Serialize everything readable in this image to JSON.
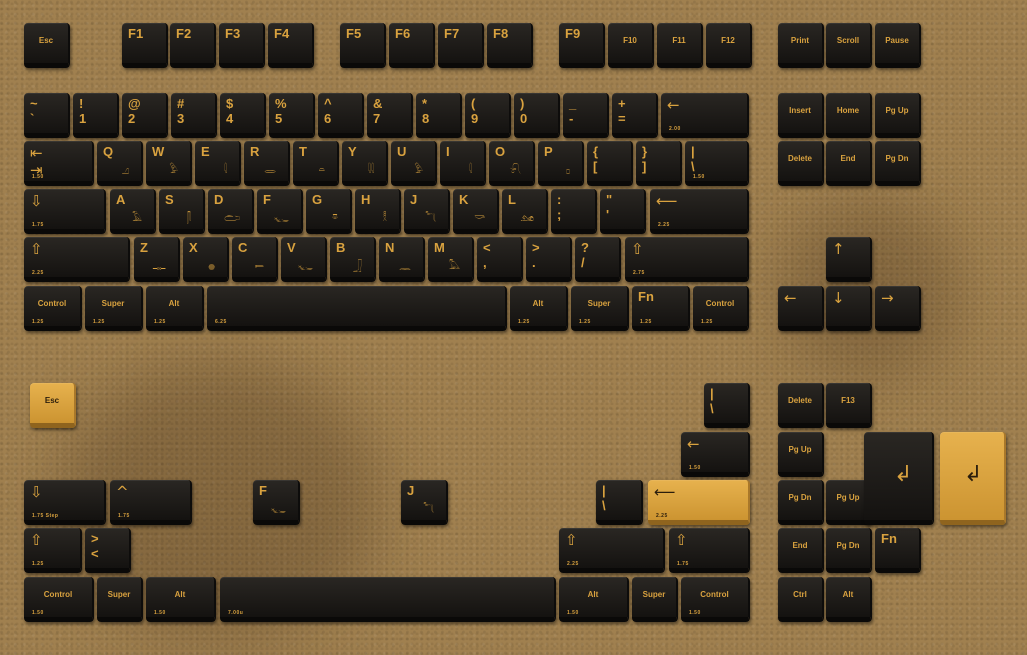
{
  "colors": {
    "mat": "#a0804f",
    "keycap": "#1e1b18",
    "legend": "#d9a23f",
    "accent_cap": "#dca540"
  },
  "main_board": {
    "function_row": [
      {
        "label": "Esc"
      },
      {
        "label": "F1"
      },
      {
        "label": "F2"
      },
      {
        "label": "F3"
      },
      {
        "label": "F4"
      },
      {
        "label": "F5"
      },
      {
        "label": "F6"
      },
      {
        "label": "F7"
      },
      {
        "label": "F8"
      },
      {
        "label": "F9"
      },
      {
        "label": "F10"
      },
      {
        "label": "F11"
      },
      {
        "label": "F12"
      }
    ],
    "system_keys": [
      {
        "label": "Print"
      },
      {
        "label": "Scroll"
      },
      {
        "label": "Pause"
      }
    ],
    "number_row": [
      {
        "label": "~\n`"
      },
      {
        "label": "!\n1"
      },
      {
        "label": "@\n2"
      },
      {
        "label": "#\n3"
      },
      {
        "label": "$\n4"
      },
      {
        "label": "%\n5"
      },
      {
        "label": "^\n6"
      },
      {
        "label": "&\n7"
      },
      {
        "label": "*\n8"
      },
      {
        "label": "(\n9"
      },
      {
        "label": ")\n0"
      },
      {
        "label": "_\n-"
      },
      {
        "label": "+\n="
      },
      {
        "label": "←",
        "size": "2.00"
      }
    ],
    "nav_cluster": [
      {
        "label": "Insert"
      },
      {
        "label": "Home"
      },
      {
        "label": "Pg Up"
      },
      {
        "label": "Delete"
      },
      {
        "label": "End"
      },
      {
        "label": "Pg Dn"
      }
    ],
    "top_row": [
      {
        "label": "⇤\n⇥",
        "size": "1.50"
      },
      {
        "label": "Q",
        "glyph": "𓈎"
      },
      {
        "label": "W",
        "glyph": "𓅱"
      },
      {
        "label": "E",
        "glyph": "𓇋"
      },
      {
        "label": "R",
        "glyph": "𓂋"
      },
      {
        "label": "T",
        "glyph": "𓏏"
      },
      {
        "label": "Y",
        "glyph": "𓇌"
      },
      {
        "label": "U",
        "glyph": "𓅱"
      },
      {
        "label": "I",
        "glyph": "𓇋"
      },
      {
        "label": "O",
        "glyph": "𓍯"
      },
      {
        "label": "P",
        "glyph": "𓊪"
      },
      {
        "label": "{\n["
      },
      {
        "label": "}\n]"
      },
      {
        "label": "|\n\\",
        "size": "1.50"
      }
    ],
    "home_row": [
      {
        "label": "⇩",
        "size": "1.75"
      },
      {
        "label": "A",
        "glyph": "𓄿"
      },
      {
        "label": "S",
        "glyph": "𓋴"
      },
      {
        "label": "D",
        "glyph": "𓂧"
      },
      {
        "label": "F",
        "glyph": "𓆑"
      },
      {
        "label": "G",
        "glyph": "𓎼"
      },
      {
        "label": "H",
        "glyph": "𓎛"
      },
      {
        "label": "J",
        "glyph": "𓆓"
      },
      {
        "label": "K",
        "glyph": "𓎡"
      },
      {
        "label": "L",
        "glyph": "𓃭"
      },
      {
        "label": ":\n;"
      },
      {
        "label": "\"\n'"
      },
      {
        "label": "⟵",
        "size": "2.25"
      }
    ],
    "bottom_row": [
      {
        "label": "⇧",
        "size": "2.25"
      },
      {
        "label": "Z",
        "glyph": "𓊃"
      },
      {
        "label": "X",
        "glyph": "𓐍"
      },
      {
        "label": "C",
        "glyph": "𓍿"
      },
      {
        "label": "V",
        "glyph": "𓆑"
      },
      {
        "label": "B",
        "glyph": "𓃀"
      },
      {
        "label": "N",
        "glyph": "𓈖"
      },
      {
        "label": "M",
        "glyph": "𓅓"
      },
      {
        "label": "<\n,"
      },
      {
        "label": ">\n."
      },
      {
        "label": "?\n/"
      },
      {
        "label": "⇧",
        "size": "2.75"
      }
    ],
    "mod_row": [
      {
        "label": "Control",
        "size": "1.25"
      },
      {
        "label": "Super",
        "size": "1.25"
      },
      {
        "label": "Alt",
        "size": "1.25"
      },
      {
        "label": "",
        "size": "6.25"
      },
      {
        "label": "Alt",
        "size": "1.25"
      },
      {
        "label": "Super",
        "size": "1.25"
      },
      {
        "label": "Fn",
        "size": "1.25"
      },
      {
        "label": "Control",
        "size": "1.25"
      }
    ],
    "arrow_keys": [
      {
        "label": "↑"
      },
      {
        "label": "←"
      },
      {
        "label": "↓"
      },
      {
        "label": "→"
      }
    ]
  },
  "extras_kit": {
    "novelty_esc": {
      "label": "Esc"
    },
    "pipe_key": {
      "label": "|\n\\"
    },
    "backspace_150": {
      "label": "←",
      "size": "1.50"
    },
    "stepped_caps": {
      "label": "⇩",
      "size": "1.75 Step"
    },
    "caret_175": {
      "label": "^",
      "size": "1.75"
    },
    "homing_f": {
      "label": "F",
      "glyph": "𓆑"
    },
    "homing_j": {
      "label": "J",
      "glyph": "𓆓"
    },
    "pipe_key_2": {
      "label": "|\n\\"
    },
    "enter_225": {
      "label": "⟵",
      "size": "2.25"
    },
    "shift_125": {
      "label": "⇧",
      "size": "1.25"
    },
    "angle_key": {
      "label": ">\n<"
    },
    "shift_225": {
      "label": "⇧",
      "size": "2.25"
    },
    "shift_175": {
      "label": "⇧",
      "size": "1.75"
    },
    "bottom_row": [
      {
        "label": "Control",
        "size": "1.50"
      },
      {
        "label": "Super"
      },
      {
        "label": "Alt",
        "size": "1.50"
      },
      {
        "label": "",
        "size": "7.00u"
      },
      {
        "label": "Alt",
        "size": "1.50"
      },
      {
        "label": "Super"
      },
      {
        "label": "Control",
        "size": "1.50"
      }
    ],
    "nav_extras": [
      {
        "label": "Delete"
      },
      {
        "label": "F13"
      },
      {
        "label": "Pg Up"
      },
      {
        "label": "Pg Dn"
      },
      {
        "label": "Pg Up"
      },
      {
        "label": "End"
      },
      {
        "label": "Pg Dn"
      },
      {
        "label": "Fn"
      },
      {
        "label": "Ctrl"
      },
      {
        "label": "Alt"
      }
    ],
    "iso_enter_black": {
      "label": "↲"
    },
    "iso_enter_gold": {
      "label": "↲"
    }
  }
}
